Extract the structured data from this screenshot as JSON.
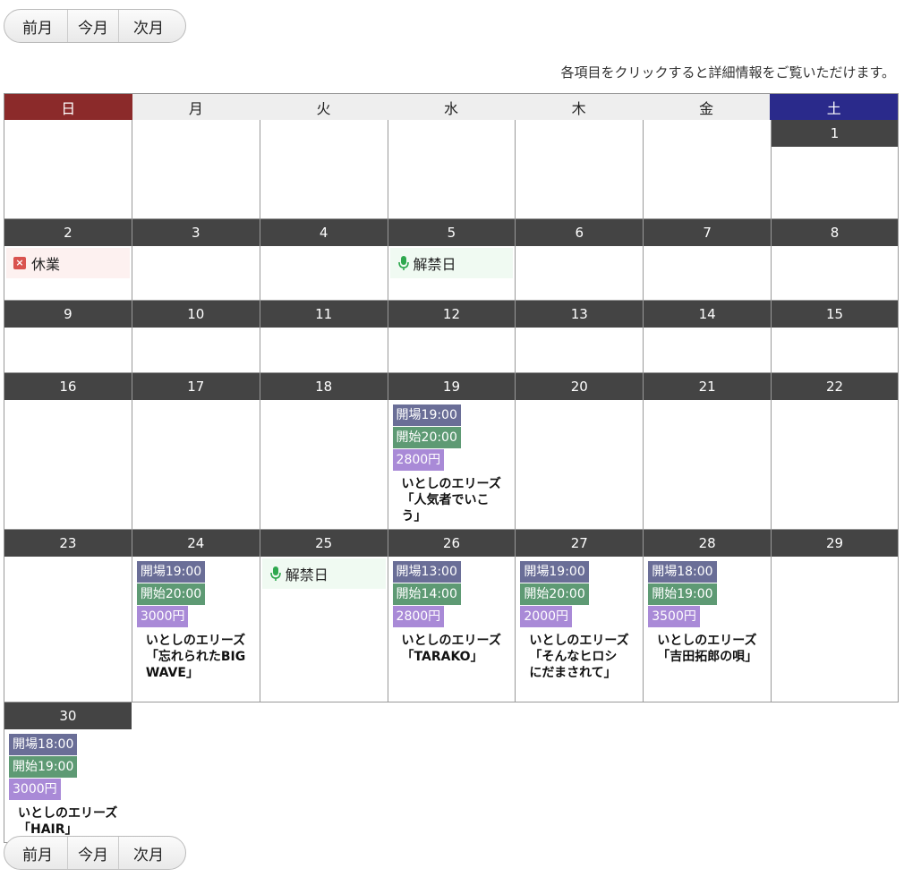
{
  "nav": {
    "prev": "前月",
    "current": "今月",
    "next": "次月"
  },
  "notice": "各項目をクリックすると詳細情報をご覧いただけます。",
  "weekdays": [
    "日",
    "月",
    "火",
    "水",
    "木",
    "金",
    "土"
  ],
  "colors": {
    "sunday": "#8b2a2a",
    "saturday": "#2a2a8b",
    "day_header": "#444444",
    "open_tag": "#6a6e97",
    "start_tag": "#5e9a74",
    "price_tag": "#a98ad7",
    "closed_icon": "#d9534f",
    "mic_icon": "#2fa84f"
  },
  "weeks": [
    {
      "height": 111,
      "days": [
        {
          "num": ""
        },
        {
          "num": ""
        },
        {
          "num": ""
        },
        {
          "num": ""
        },
        {
          "num": ""
        },
        {
          "num": ""
        },
        {
          "num": "1"
        }
      ],
      "blank_before": 6
    },
    {
      "height": 91,
      "days": [
        {
          "num": "2",
          "marker": {
            "type": "closed",
            "label": "休業"
          }
        },
        {
          "num": "3"
        },
        {
          "num": "4"
        },
        {
          "num": "5",
          "marker": {
            "type": "kaikin",
            "label": "解禁日"
          }
        },
        {
          "num": "6"
        },
        {
          "num": "7"
        },
        {
          "num": "8"
        }
      ]
    },
    {
      "height": 81,
      "days": [
        {
          "num": "9"
        },
        {
          "num": "10"
        },
        {
          "num": "11"
        },
        {
          "num": "12"
        },
        {
          "num": "13"
        },
        {
          "num": "14"
        },
        {
          "num": "15"
        }
      ]
    },
    {
      "height": 175,
      "days": [
        {
          "num": "16"
        },
        {
          "num": "17"
        },
        {
          "num": "18"
        },
        {
          "num": "19",
          "event": {
            "open": "開場19:00",
            "start": "開始20:00",
            "price": "2800円",
            "title": "いとしのエリーズ「人気者でいこう」"
          }
        },
        {
          "num": "20"
        },
        {
          "num": "21"
        },
        {
          "num": "22"
        }
      ]
    },
    {
      "height": 193,
      "days": [
        {
          "num": "23"
        },
        {
          "num": "24",
          "event": {
            "open": "開場19:00",
            "start": "開始20:00",
            "price": "3000円",
            "title": "いとしのエリーズ「忘れられたBIG WAVE」"
          }
        },
        {
          "num": "25",
          "marker": {
            "type": "kaikin",
            "label": "解禁日"
          }
        },
        {
          "num": "26",
          "event": {
            "open": "開場13:00",
            "start": "開始14:00",
            "price": "2800円",
            "title": "いとしのエリーズ「TARAKO」"
          }
        },
        {
          "num": "27",
          "event": {
            "open": "開場19:00",
            "start": "開始20:00",
            "price": "2000円",
            "title": "いとしのエリーズ「そんなヒロシにだまされて」"
          }
        },
        {
          "num": "28",
          "event": {
            "open": "開場18:00",
            "start": "開始19:00",
            "price": "3500円",
            "title": "いとしのエリーズ「吉田拓郎の唄」"
          }
        },
        {
          "num": "29"
        }
      ]
    },
    {
      "height": 157,
      "days": [
        {
          "num": "30",
          "event": {
            "open": "開場18:00",
            "start": "開始19:00",
            "price": "3000円",
            "title": "いとしのエリーズ「HAIR」"
          }
        }
      ],
      "blank_after": 6
    }
  ]
}
